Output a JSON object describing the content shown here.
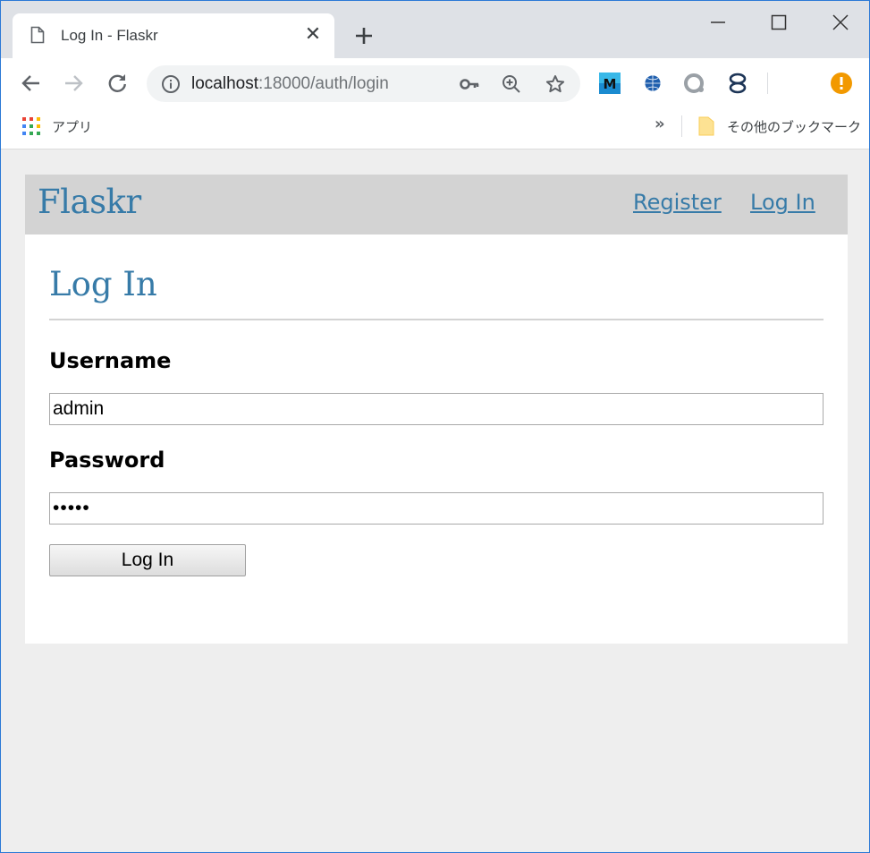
{
  "browser": {
    "tab": {
      "title": "Log In - Flaskr",
      "close_glyph": "✕"
    },
    "url": {
      "host": "localhost",
      "path": ":18000/auth/login"
    },
    "bookmarks": {
      "apps_label": "アプリ",
      "more_glyph": "»",
      "other_label": "その他のブックマーク"
    },
    "extensions": {
      "m_letter": "M"
    },
    "icons": [
      "page-icon",
      "close-icon",
      "plus-icon",
      "minimize-icon",
      "maximize-icon",
      "window-close-icon",
      "back-arrow-icon",
      "forward-arrow-icon",
      "reload-icon",
      "info-icon",
      "key-icon",
      "zoom-icon",
      "star-icon",
      "alert-icon",
      "apps-grid-icon",
      "folder-icon"
    ],
    "colors": {
      "tabstrip": "#dee1e6",
      "alert": "#f29900",
      "accent_blue": "#2b79d6"
    }
  },
  "site": {
    "brand": "Flaskr",
    "nav": {
      "register": "Register",
      "login": "Log In"
    },
    "page_title": "Log In",
    "form": {
      "username_label": "Username",
      "username_value": "admin",
      "password_label": "Password",
      "password_value": "•••••",
      "submit_label": "Log In"
    },
    "colors": {
      "link": "#377ba8",
      "nav_bg": "#d3d3d3",
      "page_bg": "#eeeeee"
    }
  }
}
